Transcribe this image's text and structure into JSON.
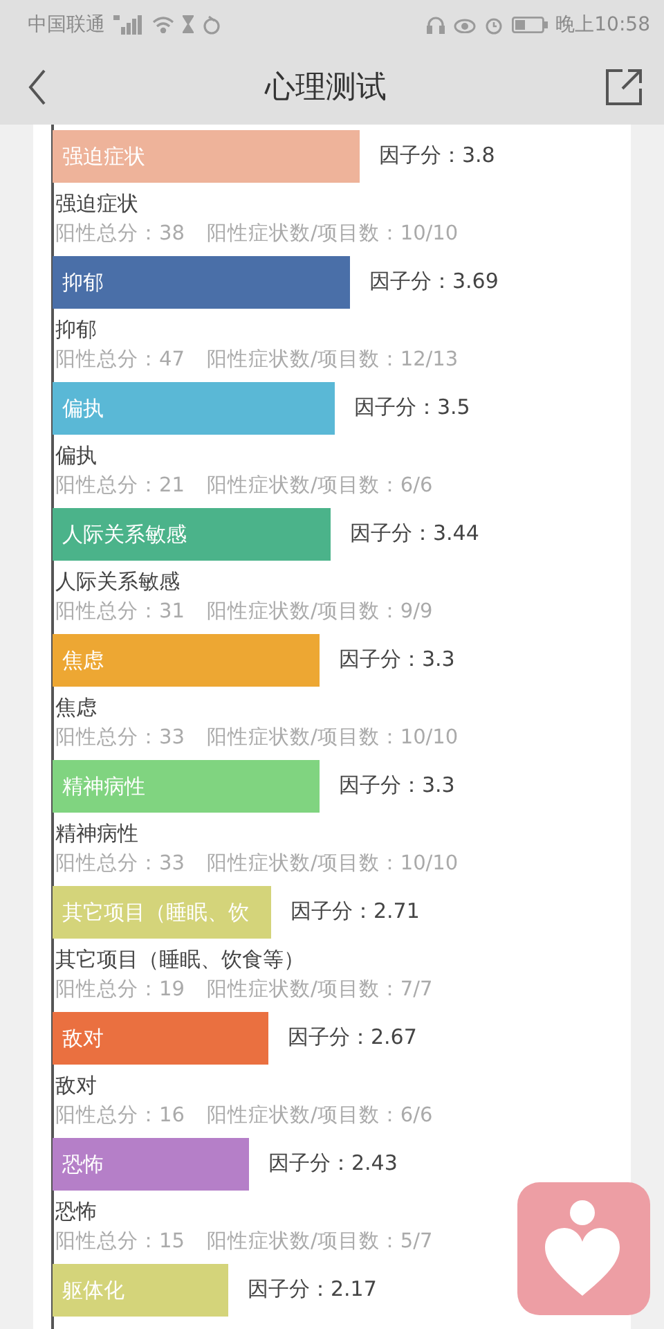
{
  "status_bar": {
    "carrier": "中国联通",
    "time": "晚上10:58"
  },
  "header": {
    "title": "心理测试"
  },
  "factors": [
    {
      "bar_label": "强迫症状",
      "color": "#eeb39a",
      "score": "因子分：3.8",
      "name": "强迫症状",
      "positive_total": "阳性总分：38",
      "ratio": "阳性症状数/项目数：10/10"
    },
    {
      "bar_label": "抑郁",
      "color": "#4a6fa8",
      "score": "因子分：3.69",
      "name": "抑郁",
      "positive_total": "阳性总分：47",
      "ratio": "阳性症状数/项目数：12/13"
    },
    {
      "bar_label": "偏执",
      "color": "#5ab8d6",
      "score": "因子分：3.5",
      "name": "偏执",
      "positive_total": "阳性总分：21",
      "ratio": "阳性症状数/项目数：6/6"
    },
    {
      "bar_label": "人际关系敏感",
      "color": "#4bb38a",
      "score": "因子分：3.44",
      "name": "人际关系敏感",
      "positive_total": "阳性总分：31",
      "ratio": "阳性症状数/项目数：9/9"
    },
    {
      "bar_label": "焦虑",
      "color": "#eda733",
      "score": "因子分：3.3",
      "name": "焦虑",
      "positive_total": "阳性总分：33",
      "ratio": "阳性症状数/项目数：10/10"
    },
    {
      "bar_label": "精神病性",
      "color": "#80d480",
      "score": "因子分：3.3",
      "name": "精神病性",
      "positive_total": "阳性总分：33",
      "ratio": "阳性症状数/项目数：10/10"
    },
    {
      "bar_label": "其它项目（睡眠、饮",
      "color": "#d4d47a",
      "score": "因子分：2.71",
      "name": "其它项目（睡眠、饮食等）",
      "positive_total": "阳性总分：19",
      "ratio": "阳性症状数/项目数：7/7"
    },
    {
      "bar_label": "敌对",
      "color": "#ea7040",
      "score": "因子分：2.67",
      "name": "敌对",
      "positive_total": "阳性总分：16",
      "ratio": "阳性症状数/项目数：6/6"
    },
    {
      "bar_label": "恐怖",
      "color": "#b57fc8",
      "score": "因子分：2.43",
      "name": "恐怖",
      "positive_total": "阳性总分：15",
      "ratio": "阳性症状数/项目数：5/7"
    },
    {
      "bar_label": "躯体化",
      "color": "#d4d47a",
      "score": "因子分：2.17"
    }
  ]
}
